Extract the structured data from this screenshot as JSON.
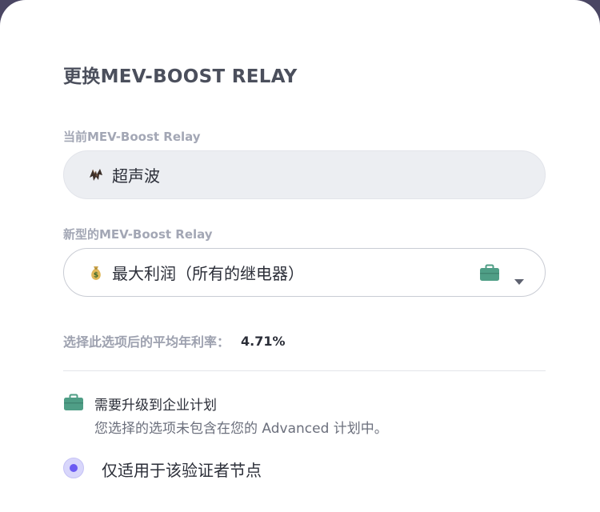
{
  "modal": {
    "title": "更换MEV-BOOST RELAY"
  },
  "current_relay": {
    "label": "当前MEV-Boost Relay",
    "icon": "bat-icon",
    "value": "超声波"
  },
  "new_relay": {
    "label": "新型的MEV-Boost Relay",
    "icon": "money-bag-icon",
    "value": "最大利润（所有的继电器）",
    "badge_icon": "briefcase-icon",
    "dropdown_icon": "caret-down-icon"
  },
  "rate": {
    "label": "选择此选项后的平均年利率：",
    "value": "4.71%"
  },
  "upgrade": {
    "icon": "briefcase-icon",
    "title": "需要升级到企业计划",
    "description": "您选择的选项未包含在您的 Advanced 计划中。"
  },
  "scope_option": {
    "label": "仅适用于该验证者节点",
    "selected": true
  },
  "colors": {
    "accent_green": "#4f9e86",
    "radio_accent": "#6b5bf2"
  }
}
